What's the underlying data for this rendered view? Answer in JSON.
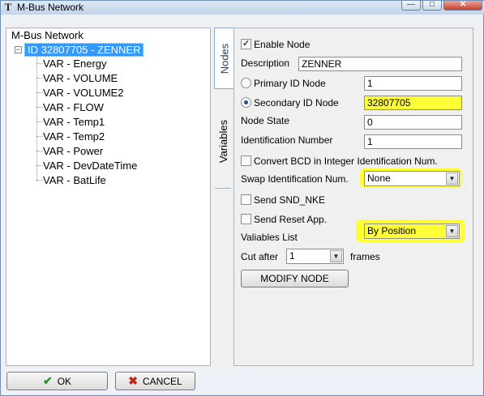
{
  "window": {
    "app_icon_glyph": "T",
    "title": "M-Bus Network",
    "minimize_glyph": "—",
    "maximize_glyph": "□",
    "close_glyph": "✕"
  },
  "tree": {
    "root_label": "M-Bus Network",
    "expander_glyph": "−",
    "selected_node": "ID 32807705 - ZENNER",
    "items": [
      {
        "label": "VAR - Energy"
      },
      {
        "label": "VAR - VOLUME"
      },
      {
        "label": "VAR - VOLUME2"
      },
      {
        "label": "VAR - FLOW"
      },
      {
        "label": "VAR - Temp1"
      },
      {
        "label": "VAR - Temp2"
      },
      {
        "label": "VAR - Power"
      },
      {
        "label": "VAR - DevDateTime"
      },
      {
        "label": "VAR - BatLife"
      }
    ]
  },
  "tabs": {
    "nodes": "Nodes",
    "variables": "Variables"
  },
  "form": {
    "enable_node_label": "Enable Node",
    "enable_node_checked": true,
    "check_glyph": "✓",
    "description_label": "Description",
    "description_value": "ZENNER",
    "primary_id_label": "Primary ID Node",
    "primary_id_value": "1",
    "secondary_id_label": "Secondary ID Node",
    "secondary_id_value": "32807705",
    "node_state_label": "Node State",
    "node_state_value": "0",
    "identification_number_label": "Identification Number",
    "identification_number_value": "1",
    "convert_bcd_label": "Convert BCD in Integer Identification Num.",
    "swap_label": "Swap Identification Num.",
    "swap_value": "None",
    "send_snd_nke_label": "Send SND_NKE",
    "send_reset_label": "Send Reset App.",
    "variables_list_label": "Valiables List",
    "variables_list_value": "By Position",
    "cut_after_label": "Cut after",
    "cut_after_value": "1",
    "frames_label": "frames",
    "modify_button": "MODIFY NODE",
    "dropdown_glyph": "▼",
    "highlight_color": "#ffff38"
  },
  "footer": {
    "ok_label": "OK",
    "ok_glyph": "✔",
    "cancel_label": "CANCEL",
    "cancel_glyph": "✖"
  }
}
